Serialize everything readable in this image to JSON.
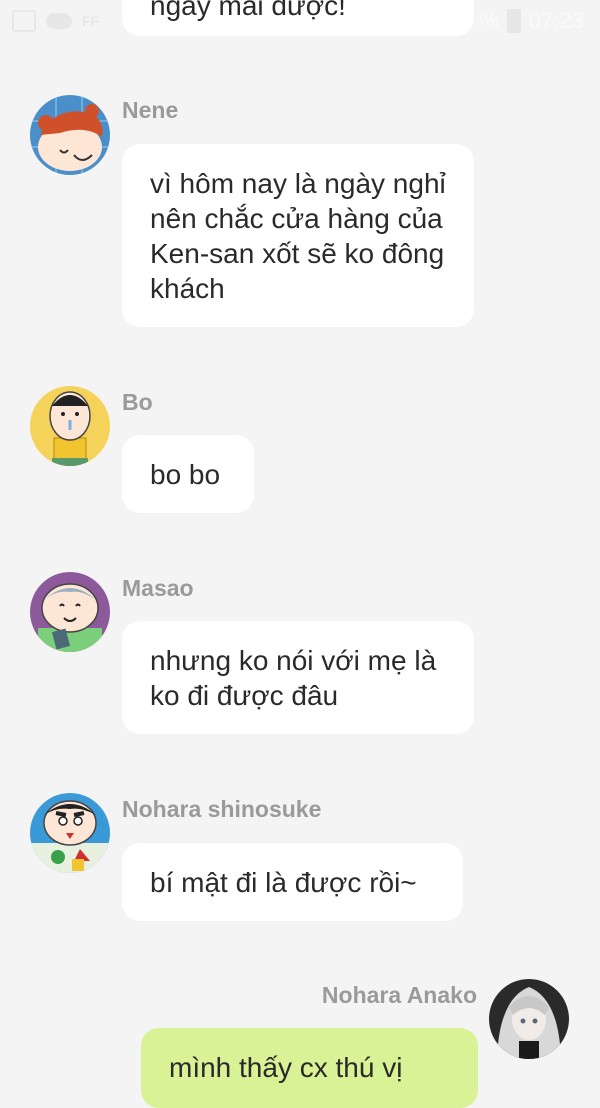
{
  "status_bar": {
    "battery": "%",
    "time": "07:23",
    "left_icons": [
      "image-icon",
      "cloud-icon",
      "ff-icon"
    ]
  },
  "messages": [
    {
      "sender": "",
      "text": "ngày mai được!",
      "mine": false
    },
    {
      "sender": "Nene",
      "text": "vì hôm nay là ngày nghỉ nên chắc cửa hàng của Ken-san xốt sẽ ko đông khách",
      "mine": false
    },
    {
      "sender": "Bo",
      "text": "bo bo",
      "mine": false
    },
    {
      "sender": "Masao",
      "text": "nhưng ko nói với mẹ là ko đi được đâu",
      "mine": false
    },
    {
      "sender": "Nohara shinosuke",
      "text": "bí mật đi là được rồi~",
      "mine": false
    },
    {
      "sender": "Nohara Anako",
      "text": "mình thấy cx thú vị",
      "mine": true
    }
  ],
  "colors": {
    "background": "#f4f4f4",
    "bubble": "#ffffff",
    "bubble_mine": "#d9f295",
    "sender": "#9a9a9a"
  }
}
